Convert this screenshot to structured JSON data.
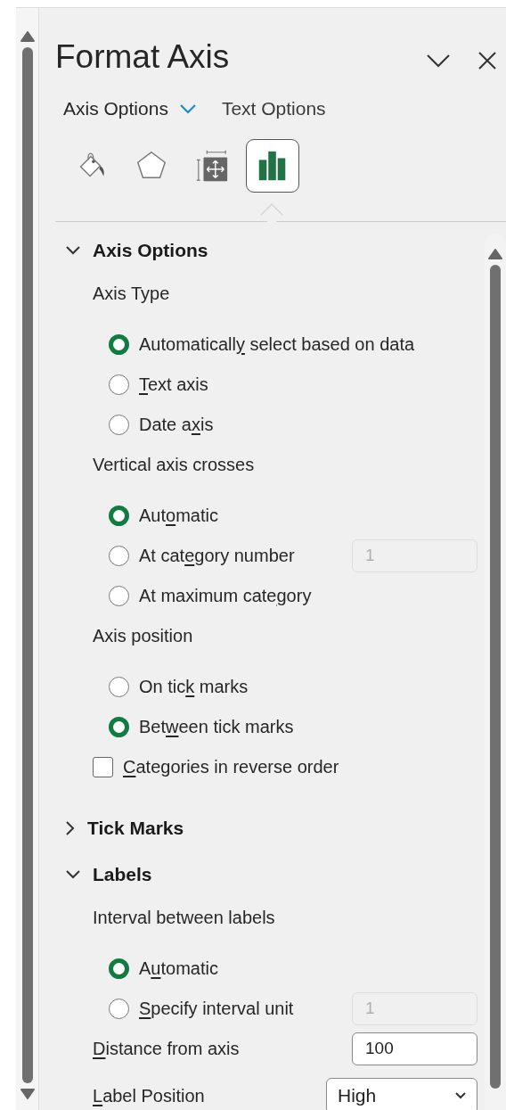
{
  "panel": {
    "title": "Format Axis"
  },
  "header_tabs": [
    {
      "label": "Axis Options",
      "selected": true
    },
    {
      "label": "Text Options",
      "selected": false
    }
  ],
  "icon_tabs": [
    {
      "kind": "fill",
      "selected": false
    },
    {
      "kind": "effects",
      "selected": false
    },
    {
      "kind": "size",
      "selected": false
    },
    {
      "kind": "axis",
      "selected": true
    }
  ],
  "sections": [
    {
      "title": "Axis Options",
      "expanded": true,
      "items": [
        {
          "kind": "heading",
          "label": "Axis Type"
        },
        {
          "kind": "radio",
          "label": {
            "before": "Automaticall",
            "key": "y",
            "after": " select based on data"
          },
          "selected": true
        },
        {
          "kind": "radio",
          "label": {
            "key": "T",
            "after": "ext axis"
          },
          "selected": false
        },
        {
          "kind": "radio",
          "label": {
            "before": "Date a",
            "key": "x",
            "after": "is"
          },
          "selected": false
        },
        {
          "kind": "heading",
          "label": "Vertical axis crosses"
        },
        {
          "kind": "radio",
          "label": {
            "before": "Aut",
            "key": "o",
            "after": "matic"
          },
          "selected": true
        },
        {
          "kind": "radio",
          "label": {
            "before": "At cat",
            "key": "e",
            "after": "gory number"
          },
          "selected": false,
          "field": {
            "value": "1",
            "disabled": true
          }
        },
        {
          "kind": "radio",
          "label": {
            "before": "At maximum cate",
            "key": "g",
            "after": "ory"
          },
          "selected": false
        },
        {
          "kind": "heading",
          "label": "Axis position"
        },
        {
          "kind": "radio",
          "label": {
            "before": "On tic",
            "key": "k",
            "after": " marks"
          },
          "selected": false
        },
        {
          "kind": "radio",
          "label": {
            "before": "Bet",
            "key": "w",
            "after": "een tick marks"
          },
          "selected": true
        },
        {
          "kind": "checkbox",
          "label": {
            "key": "C",
            "after": "ategories in reverse order"
          },
          "checked": false
        }
      ]
    },
    {
      "title": "Tick Marks",
      "expanded": false
    },
    {
      "title": "Labels",
      "expanded": true,
      "items": [
        {
          "kind": "heading",
          "label": "Interval between labels"
        },
        {
          "kind": "radio",
          "label": {
            "before": "A",
            "key": "u",
            "after": "tomatic"
          },
          "selected": true
        },
        {
          "kind": "radio",
          "label": {
            "key": "S",
            "after": "pecify interval unit"
          },
          "selected": false,
          "field": {
            "value": "1",
            "disabled": true
          }
        },
        {
          "kind": "field",
          "label": {
            "key": "D",
            "after": "istance from axis"
          },
          "value": "100"
        },
        {
          "kind": "select",
          "label": {
            "key": "L",
            "after": "abel Position"
          },
          "value": "High"
        }
      ]
    }
  ]
}
